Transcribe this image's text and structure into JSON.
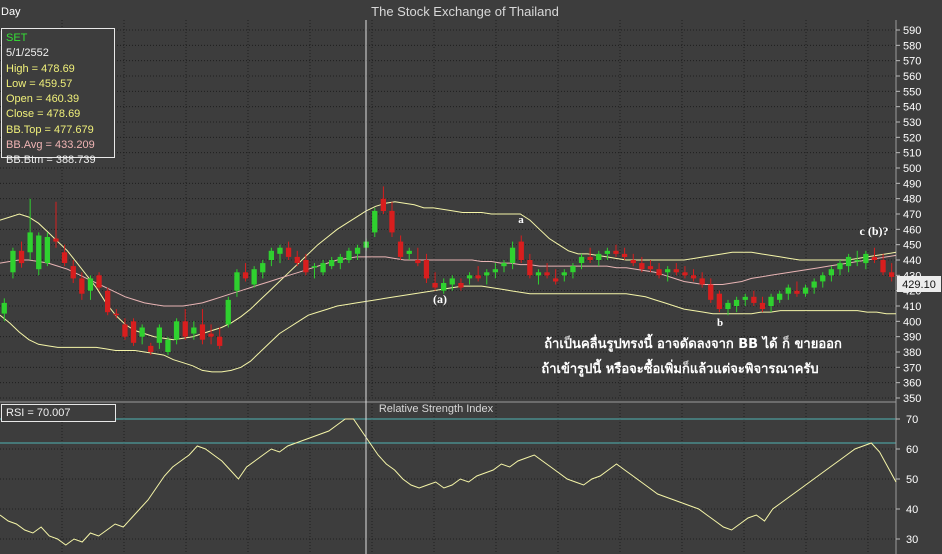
{
  "header": {
    "period": "Day",
    "title": "The Stock Exchange of Thailand"
  },
  "info_box": {
    "symbol": "SET",
    "date": "5/1/2552",
    "high": "High  = 478.69",
    "low": "Low   = 459.57",
    "open": "Open = 460.39",
    "close": "Close = 478.69",
    "bb_top": "BB.Top = 477.679",
    "bb_avg": "BB.Avg = 433.209",
    "bb_btm": "BB.Btm = 388.739"
  },
  "rsi_box": {
    "label": "RSI = 70.007"
  },
  "rsi_panel": {
    "title": "Relative Strength Index"
  },
  "last_price_label": "429.10",
  "annotations": {
    "a": "a",
    "paren_a": "(a)",
    "b": "b",
    "c_b": "c (b)?",
    "thai_line1": "ถ้าเป็นคลื่นรูปทรงนี้ อาจดัดลงจาก BB ได้  ก็ ขายออก",
    "thai_line2": "ถ้าเข้ารูปนี้ หรือจะซื้อเพิ่มก็แล้วแต่จะพิจารณาครับ"
  },
  "colors": {
    "background": "#3d3d3d",
    "grid": "#1e1e1e",
    "up_candle": "#2fd12f",
    "down_candle": "#d81e1e",
    "bb_band": "#f5f5a8",
    "bb_avg": "#e8b4b4",
    "rsi_line": "#f5f5a8",
    "rsi_level": "#4fb4b4",
    "crosshair": "#e0e0e0",
    "axis_text": "#ffffff"
  },
  "chart_data": [
    {
      "type": "candlestick",
      "title": "The Stock Exchange of Thailand",
      "ylim": [
        350,
        590
      ],
      "y_ticks": [
        350,
        360,
        370,
        380,
        390,
        400,
        410,
        420,
        430,
        440,
        450,
        460,
        470,
        480,
        490,
        500,
        510,
        520,
        530,
        540,
        550,
        560,
        570,
        580,
        590
      ],
      "grid": true,
      "ohlc": [
        [
          405,
          415,
          400,
          412
        ],
        [
          432,
          448,
          428,
          446
        ],
        [
          446,
          452,
          435,
          438
        ],
        [
          445,
          480,
          440,
          458
        ],
        [
          434,
          458,
          430,
          456
        ],
        [
          438,
          458,
          436,
          455
        ],
        [
          454,
          478,
          448,
          452
        ],
        [
          445,
          450,
          436,
          438
        ],
        [
          436,
          440,
          425,
          428
        ],
        [
          428,
          432,
          414,
          418
        ],
        [
          420,
          430,
          414,
          428
        ],
        [
          430,
          432,
          420,
          422
        ],
        [
          420,
          422,
          404,
          406
        ],
        [
          405,
          408,
          402,
          404
        ],
        [
          398,
          402,
          388,
          390
        ],
        [
          400,
          402,
          384,
          386
        ],
        [
          390,
          398,
          385,
          396
        ],
        [
          384,
          386,
          378,
          380
        ],
        [
          386,
          398,
          382,
          396
        ],
        [
          380,
          390,
          378,
          388
        ],
        [
          388,
          402,
          385,
          400
        ],
        [
          400,
          408,
          388,
          390
        ],
        [
          392,
          400,
          388,
          396
        ],
        [
          398,
          408,
          385,
          388
        ],
        [
          392,
          398,
          385,
          390
        ],
        [
          390,
          396,
          382,
          384
        ],
        [
          398,
          416,
          396,
          414
        ],
        [
          420,
          434,
          416,
          432
        ],
        [
          432,
          438,
          426,
          428
        ],
        [
          424,
          436,
          422,
          434
        ],
        [
          432,
          440,
          428,
          438
        ],
        [
          440,
          448,
          436,
          446
        ],
        [
          444,
          450,
          438,
          448
        ],
        [
          448,
          452,
          440,
          442
        ],
        [
          442,
          446,
          436,
          438
        ],
        [
          440,
          444,
          430,
          432
        ],
        [
          435,
          438,
          428,
          436
        ],
        [
          432,
          440,
          430,
          438
        ],
        [
          436,
          442,
          434,
          440
        ],
        [
          438,
          444,
          434,
          442
        ],
        [
          440,
          448,
          438,
          446
        ],
        [
          444,
          450,
          440,
          448
        ],
        [
          448,
          454,
          446,
          452
        ],
        [
          458,
          474,
          455,
          472
        ],
        [
          480,
          488,
          470,
          472
        ],
        [
          472,
          478,
          455,
          458
        ],
        [
          452,
          456,
          440,
          442
        ],
        [
          444,
          448,
          440,
          446
        ],
        [
          440,
          448,
          436,
          438
        ],
        [
          440,
          444,
          425,
          428
        ],
        [
          425,
          432,
          420,
          422
        ],
        [
          420,
          428,
          418,
          425
        ],
        [
          424,
          430,
          420,
          428
        ],
        [
          425,
          428,
          420,
          422
        ],
        [
          428,
          432,
          424,
          430
        ],
        [
          430,
          436,
          426,
          428
        ],
        [
          430,
          434,
          424,
          432
        ],
        [
          432,
          438,
          428,
          434
        ],
        [
          436,
          440,
          432,
          438
        ],
        [
          438,
          452,
          434,
          448
        ],
        [
          452,
          456,
          438,
          440
        ],
        [
          440,
          444,
          428,
          430
        ],
        [
          430,
          434,
          424,
          432
        ],
        [
          432,
          438,
          428,
          430
        ],
        [
          428,
          434,
          424,
          426
        ],
        [
          430,
          434,
          426,
          432
        ],
        [
          432,
          438,
          428,
          436
        ],
        [
          438,
          444,
          434,
          442
        ],
        [
          442,
          448,
          438,
          440
        ],
        [
          440,
          446,
          436,
          444
        ],
        [
          444,
          448,
          440,
          446
        ],
        [
          446,
          450,
          442,
          444
        ],
        [
          444,
          448,
          440,
          442
        ],
        [
          440,
          444,
          436,
          438
        ],
        [
          438,
          442,
          432,
          434
        ],
        [
          436,
          440,
          432,
          434
        ],
        [
          434,
          438,
          428,
          430
        ],
        [
          432,
          436,
          426,
          434
        ],
        [
          434,
          438,
          430,
          432
        ],
        [
          432,
          436,
          428,
          430
        ],
        [
          430,
          434,
          426,
          428
        ],
        [
          428,
          432,
          422,
          424
        ],
        [
          424,
          428,
          412,
          414
        ],
        [
          418,
          420,
          406,
          408
        ],
        [
          408,
          414,
          404,
          412
        ],
        [
          410,
          416,
          406,
          414
        ],
        [
          414,
          418,
          410,
          416
        ],
        [
          416,
          420,
          410,
          412
        ],
        [
          412,
          416,
          406,
          408
        ],
        [
          410,
          418,
          406,
          416
        ],
        [
          414,
          420,
          412,
          418
        ],
        [
          418,
          424,
          414,
          422
        ],
        [
          420,
          426,
          416,
          418
        ],
        [
          418,
          424,
          416,
          422
        ],
        [
          422,
          428,
          418,
          426
        ],
        [
          426,
          432,
          422,
          430
        ],
        [
          430,
          436,
          426,
          434
        ],
        [
          434,
          440,
          430,
          438
        ],
        [
          436,
          444,
          432,
          442
        ],
        [
          440,
          446,
          436,
          440
        ],
        [
          438,
          446,
          434,
          444
        ],
        [
          442,
          448,
          438,
          440
        ],
        [
          440,
          444,
          430,
          432
        ],
        [
          432,
          438,
          426,
          429
        ]
      ],
      "bb_top": [
        466,
        468,
        470,
        468,
        464,
        458,
        452,
        446,
        438,
        430,
        422,
        412,
        404,
        398,
        394,
        392,
        390,
        389,
        388,
        389,
        390,
        392,
        394,
        396,
        399,
        403,
        408,
        414,
        420,
        426,
        432,
        438,
        444,
        450,
        455,
        460,
        464,
        468,
        472,
        475,
        477,
        478,
        477,
        476,
        474,
        474,
        473,
        472,
        471,
        471,
        471,
        470,
        470,
        470,
        470,
        466,
        460,
        454,
        450,
        446,
        444,
        444,
        443,
        442,
        441,
        440,
        440,
        440,
        440,
        440,
        440,
        440,
        441,
        442,
        443,
        444,
        445,
        445,
        445,
        444,
        443,
        442,
        441,
        440,
        440,
        440,
        440,
        440,
        440,
        441,
        442,
        443,
        444,
        445
      ],
      "bb_avg": [
        438,
        439,
        440,
        440,
        439,
        438,
        436,
        434,
        431,
        428,
        425,
        422,
        419,
        416,
        414,
        412,
        411,
        410,
        410,
        410,
        411,
        412,
        414,
        416,
        418,
        420,
        422,
        424,
        426,
        428,
        430,
        432,
        434,
        436,
        438,
        440,
        441,
        442,
        442,
        442,
        442,
        441,
        440,
        440,
        440,
        440,
        440,
        440,
        440,
        440,
        439,
        439,
        438,
        438,
        437,
        437,
        436,
        436,
        436,
        436,
        436,
        436,
        436,
        436,
        435,
        435,
        434,
        433,
        432,
        430,
        428,
        426,
        425,
        424,
        424,
        424,
        425,
        426,
        428,
        429,
        430,
        431,
        432,
        433,
        434,
        435,
        436,
        437,
        438,
        439,
        440,
        441,
        442,
        443
      ],
      "bb_btm": [
        404,
        399,
        393,
        388,
        385,
        384,
        383,
        383,
        383,
        383,
        383,
        382,
        381,
        381,
        381,
        380,
        379,
        378,
        375,
        373,
        371,
        368,
        367,
        367,
        368,
        370,
        374,
        380,
        386,
        392,
        396,
        400,
        404,
        406,
        408,
        410,
        411,
        412,
        413,
        414,
        415,
        416,
        417,
        418,
        419,
        420,
        421,
        422,
        423,
        423,
        423,
        422,
        421,
        420,
        419,
        418,
        418,
        418,
        418,
        418,
        418,
        418,
        418,
        418,
        418,
        418,
        417,
        416,
        414,
        412,
        410,
        408,
        407,
        406,
        405,
        405,
        405,
        405,
        405,
        406,
        406,
        407,
        407,
        407,
        407,
        407,
        407,
        407,
        407,
        407,
        406,
        406,
        405,
        405
      ]
    },
    {
      "type": "line",
      "title": "Relative Strength Index",
      "ylim": [
        25,
        75
      ],
      "y_ticks": [
        30,
        40,
        50,
        60,
        70
      ],
      "levels": [
        70,
        62
      ],
      "values": [
        38,
        36,
        35,
        33,
        32,
        34,
        31,
        30,
        28,
        30,
        29,
        32,
        31,
        33,
        35,
        34,
        37,
        40,
        43,
        47,
        51,
        54,
        56,
        58,
        61,
        60,
        58,
        56,
        53,
        50,
        54,
        56,
        58,
        60,
        59,
        61,
        62,
        63,
        64,
        65,
        66,
        68,
        70,
        70,
        66,
        62,
        58,
        55,
        53,
        50,
        48,
        47,
        48,
        49,
        47,
        48,
        50,
        49,
        51,
        52,
        53,
        55,
        54,
        56,
        57,
        58,
        56,
        54,
        52,
        50,
        49,
        48,
        50,
        51,
        53,
        55,
        53,
        51,
        49,
        47,
        45,
        44,
        43,
        42,
        41,
        40,
        38,
        36,
        34,
        33,
        35,
        37,
        38,
        36,
        40,
        42,
        44,
        46,
        48,
        50,
        52,
        54,
        56,
        58,
        60,
        61,
        62,
        59,
        54,
        49
      ]
    }
  ]
}
